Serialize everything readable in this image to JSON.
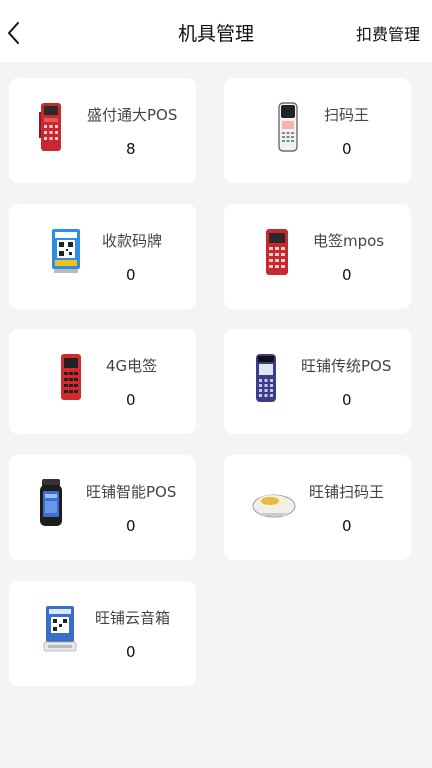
{
  "header": {
    "title": "机具管理",
    "fee_label": "扣费管理"
  },
  "devices": [
    {
      "name": "盛付通大POS",
      "count": "8",
      "icon": "red-pos-terminal-icon"
    },
    {
      "name": "扫码王",
      "count": "0",
      "icon": "qr-scanner-icon"
    },
    {
      "name": "收款码牌",
      "count": "0",
      "icon": "qr-code-stand-icon"
    },
    {
      "name": "电签mpos",
      "count": "0",
      "icon": "red-mpos-terminal-icon"
    },
    {
      "name": "4G电签",
      "count": "0",
      "icon": "red-4g-terminal-icon"
    },
    {
      "name": "旺铺传统POS",
      "count": "0",
      "icon": "traditional-pos-icon"
    },
    {
      "name": "旺铺智能POS",
      "count": "0",
      "icon": "smart-pos-icon"
    },
    {
      "name": "旺铺扫码王",
      "count": "0",
      "icon": "wangpu-scanner-icon"
    },
    {
      "name": "旺铺云音箱",
      "count": "0",
      "icon": "cloud-speaker-icon"
    }
  ]
}
